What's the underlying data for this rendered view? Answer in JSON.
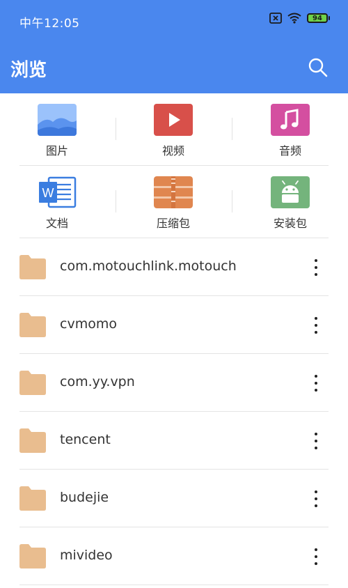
{
  "status_bar": {
    "time": "中午12:05",
    "battery": "94"
  },
  "app_bar": {
    "title": "浏览"
  },
  "categories": [
    {
      "label": "图片",
      "icon": "image-icon"
    },
    {
      "label": "视频",
      "icon": "video-icon"
    },
    {
      "label": "音频",
      "icon": "music-icon"
    },
    {
      "label": "文档",
      "icon": "word-document-icon"
    },
    {
      "label": "压缩包",
      "icon": "zip-archive-icon"
    },
    {
      "label": "安装包",
      "icon": "android-apk-icon"
    }
  ],
  "folders": [
    {
      "name": "com.motouchlink.motouch"
    },
    {
      "name": "cvmomo"
    },
    {
      "name": "com.yy.vpn"
    },
    {
      "name": "tencent"
    },
    {
      "name": "budejie"
    },
    {
      "name": "mivideo"
    }
  ],
  "colors": {
    "accent": "#4a87ee",
    "folder": "#e9bd8f",
    "video": "#d8504a",
    "music": "#d44fa0",
    "zip": "#e0864f",
    "apk": "#74b47c",
    "word": "#3a7de0"
  }
}
